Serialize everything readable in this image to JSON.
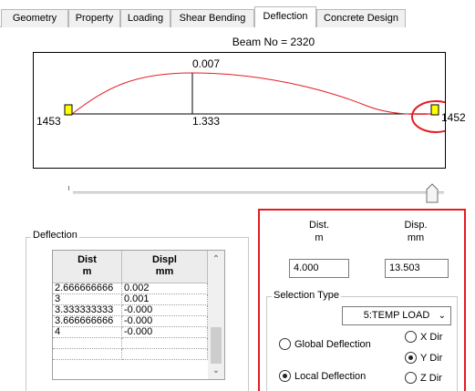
{
  "tabs": [
    {
      "label": "Geometry",
      "active": false
    },
    {
      "label": "Property",
      "active": false
    },
    {
      "label": "Loading",
      "active": false
    },
    {
      "label": "Shear Bending",
      "active": false
    },
    {
      "label": "Deflection",
      "active": true
    },
    {
      "label": "Concrete Design",
      "active": false
    }
  ],
  "beam_title": "Beam No = 2320",
  "diagram": {
    "max_label": "0.007",
    "mid_label": "1.333",
    "left_node": "1453",
    "right_node": "1452",
    "curve_color": "#e31d23",
    "support_color": "#ffff00",
    "highlight_color": "#e31d23"
  },
  "slider": {
    "position": 1.0
  },
  "deflection_group": {
    "legend": "Deflection",
    "headers": [
      {
        "line1": "Dist",
        "line2": "m"
      },
      {
        "line1": "Displ",
        "line2": "mm"
      }
    ],
    "rows": [
      {
        "dist": "2.666666666",
        "displ": "0.002"
      },
      {
        "dist": "3",
        "displ": "0.001"
      },
      {
        "dist": "3.333333333",
        "displ": "-0.000"
      },
      {
        "dist": "3.666666666",
        "displ": "-0.000"
      },
      {
        "dist": "4",
        "displ": "-0.000"
      },
      {
        "dist": "",
        "displ": ""
      },
      {
        "dist": "",
        "displ": ""
      }
    ]
  },
  "right_panel": {
    "dist_header": {
      "line1": "Dist.",
      "line2": "m"
    },
    "disp_header": {
      "line1": "Disp.",
      "line2": "mm"
    },
    "dist_value": "4.000",
    "disp_value": "13.503",
    "border_color": "#e31d23",
    "selection_type": {
      "legend": "Selection Type",
      "load_case": "5:TEMP LOAD",
      "global_label": "Global Deflection",
      "local_label": "Local Deflection",
      "deflection_mode": "local",
      "x_dir": "X Dir",
      "y_dir": "Y Dir",
      "z_dir": "Z Dir",
      "direction": "y"
    }
  }
}
